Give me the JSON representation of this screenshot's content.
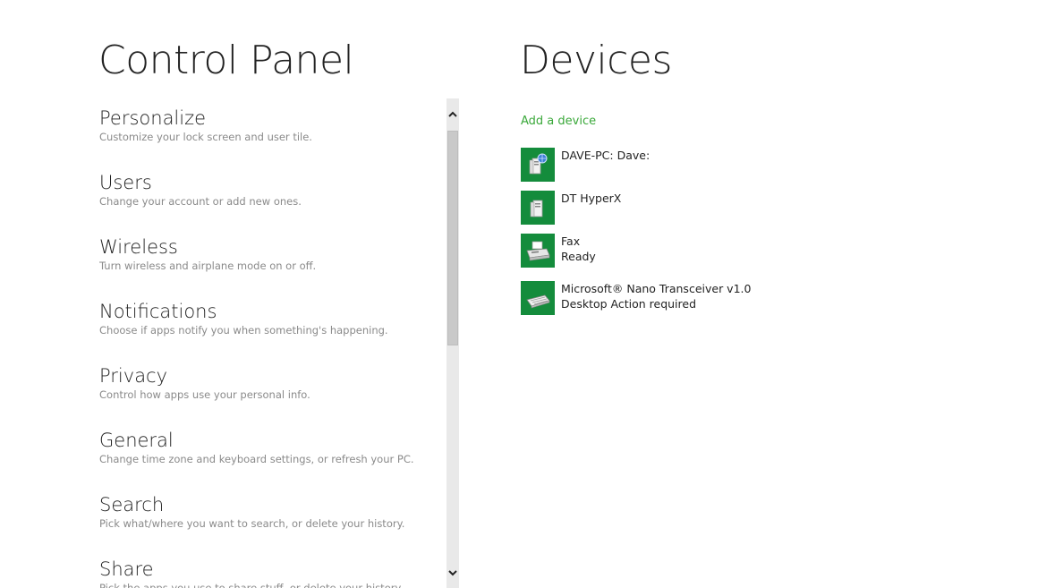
{
  "control_panel": {
    "title": "Control Panel",
    "items": [
      {
        "label": "Personalize",
        "description": "Customize your lock screen and user tile."
      },
      {
        "label": "Users",
        "description": "Change your account or add new ones."
      },
      {
        "label": "Wireless",
        "description": "Turn wireless and airplane mode on or off."
      },
      {
        "label": "Notifications",
        "description": "Choose if apps notify you when something's happening."
      },
      {
        "label": "Privacy",
        "description": "Control how apps use your personal info."
      },
      {
        "label": "General",
        "description": "Change time zone and keyboard settings, or refresh your PC."
      },
      {
        "label": "Search",
        "description": "Pick what/where you want to search, or delete your history."
      },
      {
        "label": "Share",
        "description": "Pick the apps you use to share stuff, or delete your history."
      }
    ]
  },
  "scrollbar": {
    "up_icon": "chevron-up-icon",
    "down_icon": "chevron-down-icon"
  },
  "devices": {
    "title": "Devices",
    "add_label": "Add a device",
    "accent_color": "#148c3c",
    "link_color": "#3aa83a",
    "items": [
      {
        "name": "DAVE-PC: Dave:",
        "status": "",
        "icon": "computer-network-icon"
      },
      {
        "name": "DT HyperX",
        "status": "",
        "icon": "usb-drive-icon"
      },
      {
        "name": "Fax",
        "status": "Ready",
        "icon": "fax-printer-icon"
      },
      {
        "name": "Microsoft® Nano Transceiver v1.0",
        "status": "Desktop Action required",
        "icon": "keyboard-icon"
      }
    ]
  }
}
